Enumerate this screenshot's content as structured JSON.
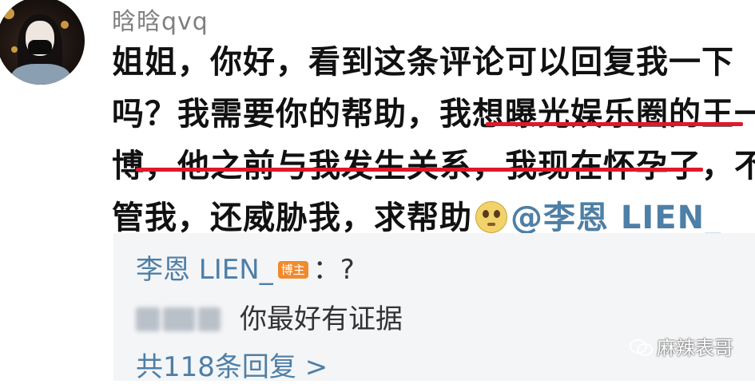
{
  "user": {
    "name": "晗晗qvq"
  },
  "comment": {
    "lines": [
      "姐姐，你好，看到这条评论可以回复我一下",
      "吗？我需要你的帮助，我想曝光娱乐圈的王一",
      "博，他之前与我发生关系，我现在怀孕了，不"
    ],
    "last_line_text": "管我，还威胁我，求帮助",
    "emoji": "emoji-pleading",
    "mention": "@李恩 LIEN_"
  },
  "replies": {
    "first": {
      "author": "李恩 LIEN_",
      "badge": "博主",
      "text": "：?"
    },
    "second": {
      "text": "你最好有证据"
    },
    "total": "共118条回复 >"
  },
  "watermark": "麻辣表哥",
  "colors": {
    "link": "#4e7fa6",
    "underline": "#e0182a",
    "badge": "#f08a2c",
    "reply_bg": "#f4f5f7"
  }
}
